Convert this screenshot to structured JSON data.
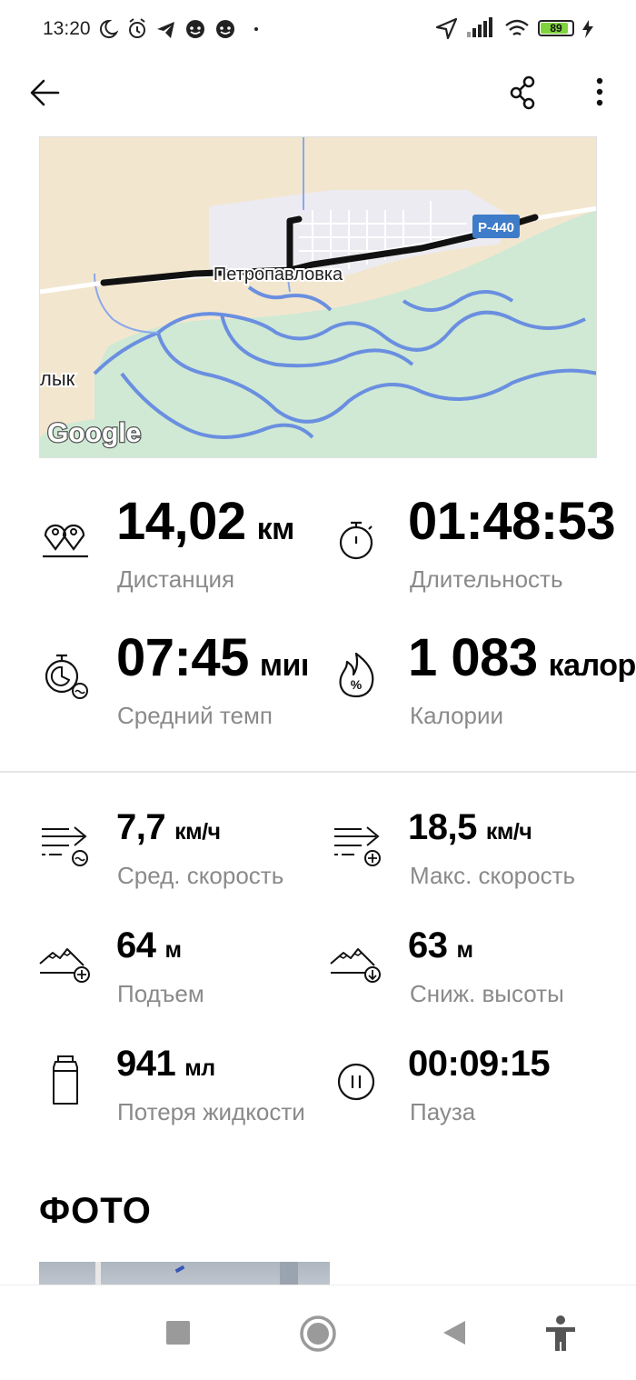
{
  "status_bar": {
    "time": "13:20",
    "battery": "89",
    "battery_level": 0.89
  },
  "app_bar": {
    "icons": [
      "back-arrow-icon",
      "share-icon",
      "more-vert-icon"
    ]
  },
  "map": {
    "town_label": "Петропавловка",
    "road_label": "Р-440",
    "partial_label": "лык",
    "attribution": "Google"
  },
  "main_stats": [
    {
      "icon": "distance-pins-icon",
      "value": "14,02",
      "unit": "км",
      "label": "Дистанция"
    },
    {
      "icon": "stopwatch-icon",
      "value": "01:48:53",
      "unit": "",
      "label": "Длительность"
    },
    {
      "icon": "pace-icon",
      "value": "07:45",
      "unit": "мин",
      "label": "Средний темп"
    },
    {
      "icon": "calories-flame-icon",
      "value": "1 083",
      "unit": "калорий",
      "label": "Калории"
    }
  ],
  "extra_stats": [
    {
      "icon": "avg-speed-icon",
      "value": "7,7",
      "unit": "км/ч",
      "label": "Сред. скорость"
    },
    {
      "icon": "max-speed-icon",
      "value": "18,5",
      "unit": "км/ч",
      "label": "Макс. скорость"
    },
    {
      "icon": "ascent-icon",
      "value": "64",
      "unit": "м",
      "label": "Подъем"
    },
    {
      "icon": "descent-icon",
      "value": "63",
      "unit": "м",
      "label": "Сниж. высоты"
    },
    {
      "icon": "water-bottle-icon",
      "value": "941",
      "unit": "мл",
      "label": "Потеря жидкости"
    },
    {
      "icon": "pause-icon",
      "value": "00:09:15",
      "unit": "",
      "label": "Пауза"
    }
  ],
  "photos_section": {
    "title": "ФОТО"
  },
  "nav_bar": {
    "icons": [
      "recents-square-icon",
      "home-circle-icon",
      "back-triangle-icon",
      "accessibility-icon"
    ]
  },
  "colors": {
    "label_gray": "#8a8a8a",
    "map_land": "#f3e6cf",
    "map_forest": "#cfe9d4",
    "map_water": "#6a8fe0",
    "road_badge": "#3e7bc8"
  }
}
